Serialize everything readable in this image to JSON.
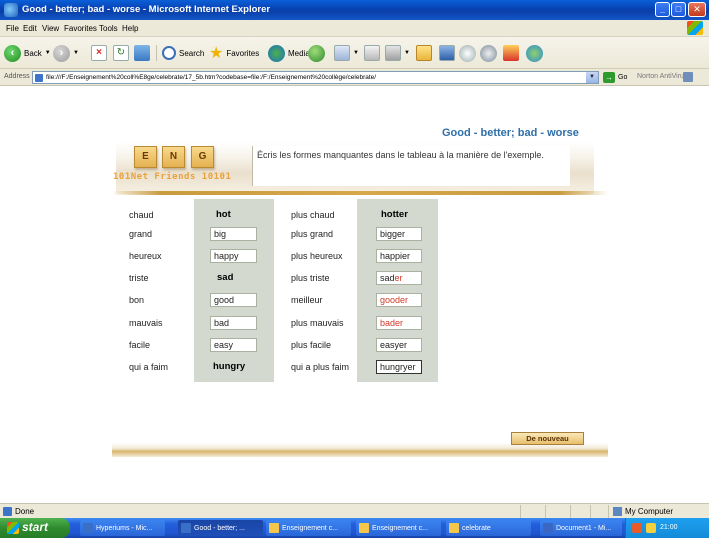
{
  "window": {
    "title": "Good - better; bad - worse - Microsoft Internet Explorer",
    "controls": {
      "minimize": "_",
      "maximize": "□",
      "close": "✕"
    }
  },
  "menu": [
    "File",
    "Edit",
    "View",
    "Favorites",
    "Tools",
    "Help"
  ],
  "toolbar": {
    "back": "Back",
    "search": "Search",
    "favorites": "Favorites",
    "media": "Media"
  },
  "address": {
    "label": "Address",
    "value": "file:///F:/Enseignement%20coll%E8ge/celebrate/17_5b.htm?codebase=file:/F:/Enseignement%20collège/celebrate/",
    "go": "Go",
    "norton": "Norton AntiVirus"
  },
  "banner": {
    "tiles": [
      "E",
      "N",
      "G"
    ],
    "brand": "101Net Friends 10101",
    "title": "Good - better; bad - worse",
    "instruction": "Écris les formes manquantes dans le tableau à la manière de l'exemple."
  },
  "rows": [
    {
      "fr": "chaud",
      "en": "hot",
      "fr_comp": "plus chaud",
      "en_comp": "hotter"
    },
    {
      "fr": "grand",
      "en": "big",
      "fr_comp": "plus grand",
      "en_comp": "bigger"
    },
    {
      "fr": "heureux",
      "en": "happy",
      "fr_comp": "plus heureux",
      "en_comp": "happier"
    },
    {
      "fr": "triste",
      "en": "sad",
      "fr_comp": "plus triste",
      "en_comp_stem": "sad",
      "en_comp_suffix": "er"
    },
    {
      "fr": "bon",
      "en": "good",
      "fr_comp": "meilleur",
      "en_comp_red": "gooder"
    },
    {
      "fr": "mauvais",
      "en": "bad",
      "fr_comp": "plus mauvais",
      "en_comp_red": "bader"
    },
    {
      "fr": "facile",
      "en": "easy",
      "fr_comp": "plus facile",
      "en_comp": "easyer"
    },
    {
      "fr": "qui a faim",
      "en": "hungry",
      "fr_comp": "qui a plus faim",
      "en_comp": "hungryer"
    }
  ],
  "button_again": "De nouveau",
  "status": {
    "left": "Done",
    "zone": "My Computer"
  },
  "taskbar": {
    "start": "start",
    "tasks": [
      "Hyperiums - Mic...",
      "Good - better; ...",
      "Enseignement c...",
      "Enseignement c...",
      "celebrate",
      "Document1 - Mi..."
    ],
    "clock": "21:00"
  },
  "colors": {
    "title_blue": "#2f6fa8",
    "mistake_red": "#d23a2a",
    "column_bg": "#d3d9cf",
    "button_gold": "#e7be6c"
  }
}
